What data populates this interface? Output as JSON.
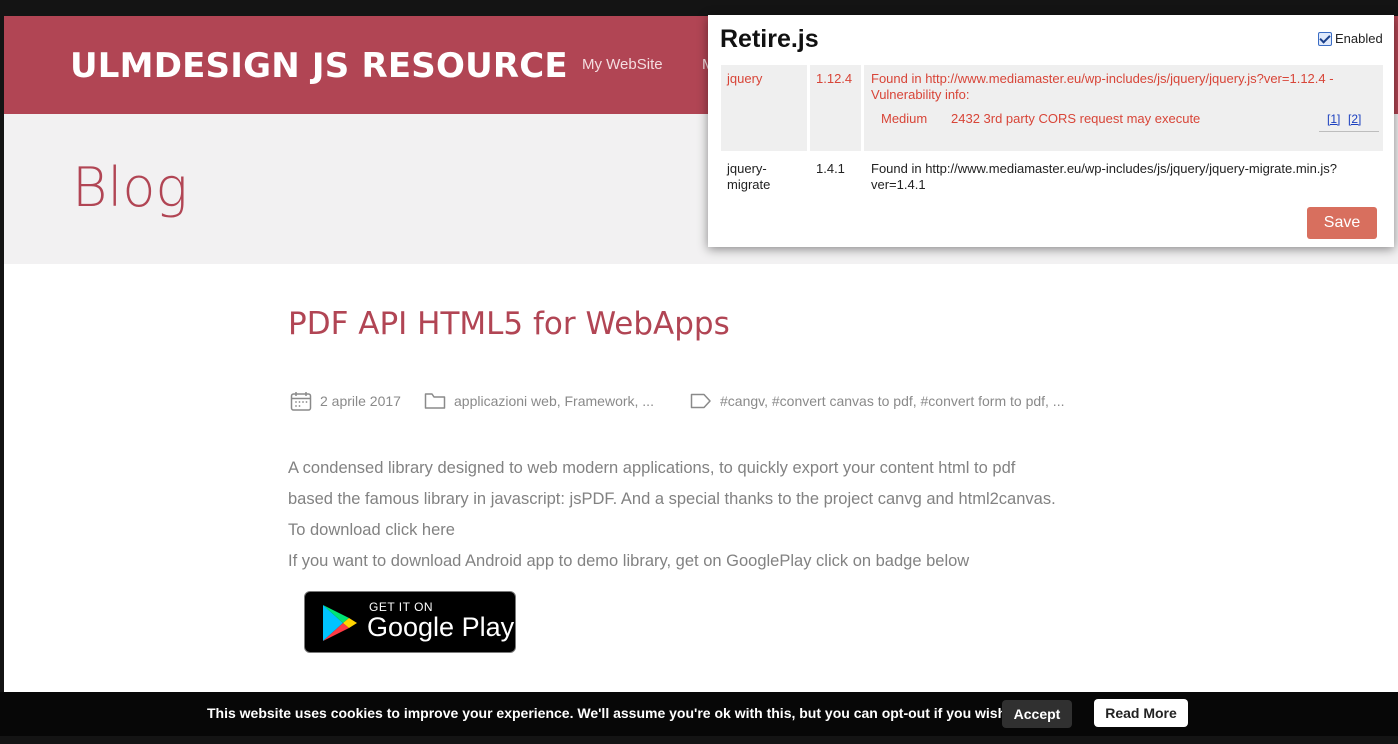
{
  "site": {
    "title": "ULMDESIGN JS RESOURCE",
    "nav": [
      "My WebSite",
      "M"
    ]
  },
  "hero": {
    "title": "Blog"
  },
  "post": {
    "title": "PDF API HTML5 for WebApps",
    "meta": {
      "date": "2 aprile 2017",
      "categories": "applicazioni web, Framework, ...",
      "tags": "#cangv, #convert canvas to pdf, #convert form to pdf, ..."
    },
    "paragraphs": [
      "A condensed library designed to web modern applications, to quickly export your content html to pdf",
      "based the famous library in javascript: jsPDF. And a special thanks to the project canvg and html2canvas.",
      "To download click here",
      "If you want to download Android app to demo library, get on GooglePlay click on badge below"
    ],
    "badge": {
      "small": "GET IT ON",
      "big": "Google Play"
    }
  },
  "cookie": {
    "text": "This website uses cookies to improve your experience. We'll assume you're ok with this, but you can opt-out if you wish.",
    "accept": "Accept",
    "read_more": "Read More"
  },
  "retire": {
    "title": "Retire.js",
    "enabled_label": "Enabled",
    "enabled": true,
    "rows": [
      {
        "name": "jquery",
        "version": "1.12.4",
        "found_line1": "Found in http://www.mediamaster.eu/wp-includes/js/jquery/jquery.js?ver=1.12.4 -",
        "found_line2": "Vulnerability info:",
        "severity": "Medium",
        "issue": "2432 3rd party CORS request may execute",
        "link1": "[1]",
        "link2": "[2]"
      },
      {
        "name_line1": "jquery-",
        "name_line2": "migrate",
        "version": "1.4.1",
        "found_line1": "Found in http://www.mediamaster.eu/wp-includes/js/jquery/jquery-migrate.min.js?",
        "found_line2": "ver=1.4.1"
      }
    ],
    "save": "Save"
  },
  "colors": {
    "brand": "#b14554",
    "vuln_text": "#d84538",
    "save_button": "#d86f5e"
  }
}
